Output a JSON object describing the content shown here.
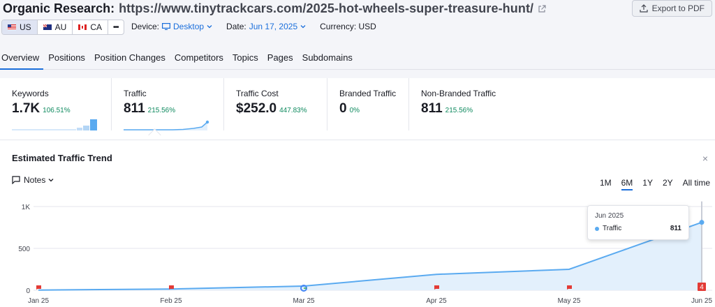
{
  "header": {
    "title": "Organic Research:",
    "url": "https://www.tinytrackcars.com/2025-hot-wheels-super-treasure-hunt/",
    "export_label": "Export to PDF"
  },
  "databases": [
    {
      "code": "US",
      "flag": "us-flag-icon"
    },
    {
      "code": "AU",
      "flag": "au-flag-icon"
    },
    {
      "code": "CA",
      "flag": "ca-flag-icon"
    }
  ],
  "more_label": "•••",
  "filters": {
    "device_label": "Device:",
    "device_value": "Desktop",
    "date_label": "Date:",
    "date_value": "Jun 17, 2025",
    "currency": "Currency: USD"
  },
  "tabs": [
    "Overview",
    "Positions",
    "Position Changes",
    "Competitors",
    "Topics",
    "Pages",
    "Subdomains"
  ],
  "metrics": [
    {
      "label": "Keywords",
      "value": "1.7K",
      "change": "106.51%"
    },
    {
      "label": "Traffic",
      "value": "811",
      "change": "215.56%"
    },
    {
      "label": "Traffic Cost",
      "value": "$252.0",
      "change": "447.83%"
    },
    {
      "label": "Branded Traffic",
      "value": "0",
      "change": "0%"
    },
    {
      "label": "Non-Branded Traffic",
      "value": "811",
      "change": "215.56%"
    }
  ],
  "trend": {
    "title": "Estimated Traffic Trend",
    "notes_label": "Notes",
    "close": "×",
    "ranges": [
      "1M",
      "6M",
      "1Y",
      "2Y",
      "All time"
    ],
    "active_range": "6M"
  },
  "tooltip": {
    "period": "Jun 2025",
    "label": "Traffic",
    "value": "811"
  },
  "colors": {
    "accent": "#1a6edb",
    "line": "#5aaaf0",
    "fill": "#e3f0fc",
    "positive": "#0f8a5f",
    "marker": "#e33b36"
  },
  "chart_data": {
    "type": "area",
    "x": [
      "Jan 25",
      "Feb 25",
      "Mar 25",
      "Apr 25",
      "May 25",
      "Jun 25"
    ],
    "series": [
      {
        "name": "Traffic",
        "values": [
          2,
          15,
          50,
          190,
          250,
          811
        ]
      }
    ],
    "xticks": [
      "Jan 25",
      "Feb 25",
      "Mar 25",
      "Apr 25",
      "May 25",
      "Jun 25"
    ],
    "yticks": [
      0,
      500,
      1000
    ],
    "ytick_labels": [
      "0",
      "500",
      "1K"
    ],
    "ylim": [
      0,
      1100
    ],
    "last_point": 811,
    "markers": [
      {
        "x": "Jan 25",
        "type": "flag-icon"
      },
      {
        "x": "Feb 25",
        "type": "flag-icon"
      },
      {
        "x": "Mar 25",
        "type": "google-icon"
      },
      {
        "x": "Apr 25",
        "type": "flag-icon"
      },
      {
        "x": "May 25",
        "type": "flag-icon"
      },
      {
        "x": "Jun 25",
        "type": "count-badge",
        "label": "4"
      }
    ],
    "grid": true,
    "legend": "none"
  }
}
